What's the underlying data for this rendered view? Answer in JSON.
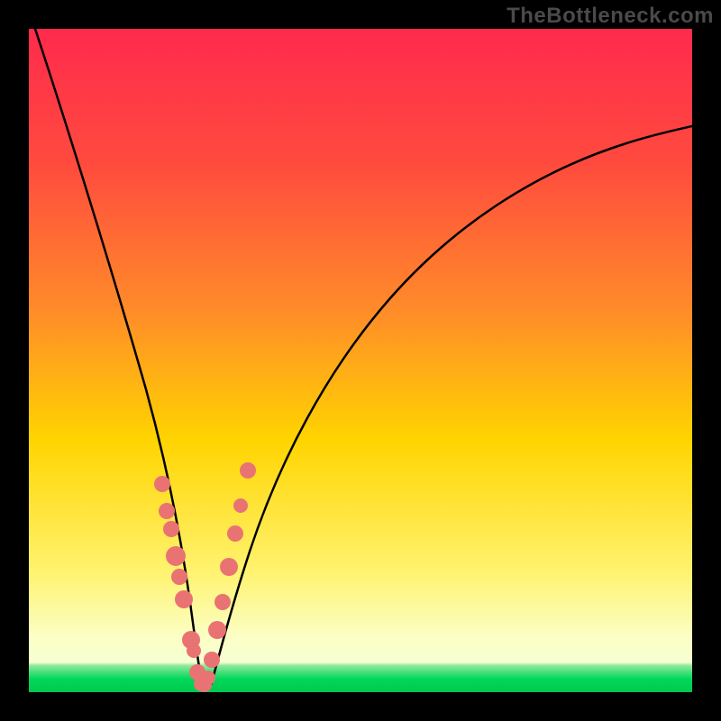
{
  "watermark": "TheBottleneck.com",
  "colors": {
    "frame": "#000000",
    "gradient_top": "#ff2a4d",
    "gradient_upper_mid": "#ff7a2f",
    "gradient_mid": "#ffd400",
    "gradient_lower_mid": "#f6ff6a",
    "gradient_bottom_band": "#f8ffd0",
    "gradient_green": "#00d85a",
    "curve": "#000000",
    "marker": "#e97373"
  },
  "chart_data": {
    "type": "line",
    "title": "",
    "xlabel": "",
    "ylabel": "",
    "xlim": [
      0,
      100
    ],
    "ylim": [
      0,
      100
    ],
    "grid": false,
    "axis_visible": false,
    "note": "Axes are not ticked or labeled; values are approximate proportions read from the plotted geometry. y=0 at bottom, y=100 at top.",
    "series": [
      {
        "name": "bottleneck-curve",
        "style": "line",
        "x": [
          0,
          4,
          8,
          12,
          16,
          18,
          20,
          22,
          24,
          25,
          26,
          27,
          28,
          30,
          32,
          36,
          40,
          46,
          54,
          63,
          74,
          87,
          100
        ],
        "y": [
          100,
          86,
          72,
          56,
          39,
          30,
          22,
          14,
          7,
          2.5,
          0.5,
          0.5,
          2,
          8,
          15,
          26,
          36,
          48,
          59,
          67,
          74,
          79,
          82
        ]
      },
      {
        "name": "marker-points",
        "style": "scatter",
        "x": [
          20.0,
          20.6,
          21.4,
          22.0,
          22.6,
          23.3,
          24.3,
          24.7,
          25.3,
          25.8,
          26.3,
          26.8,
          27.4,
          28.2,
          29.0,
          30.0,
          31.0,
          31.8,
          32.8
        ],
        "y": [
          30.5,
          26.5,
          24.0,
          20.0,
          17.0,
          13.5,
          7.5,
          6.0,
          2.5,
          0.8,
          0.8,
          2.0,
          4.5,
          9.0,
          13.0,
          18.5,
          23.5,
          28.0,
          33.0
        ]
      }
    ],
    "gradient_bands_y": {
      "red_to_orange": [
        55,
        100
      ],
      "orange_to_yellow": [
        30,
        55
      ],
      "yellow_to_pale": [
        6,
        30
      ],
      "pale_band": [
        3.5,
        6
      ],
      "green_band": [
        0,
        3.5
      ]
    }
  }
}
